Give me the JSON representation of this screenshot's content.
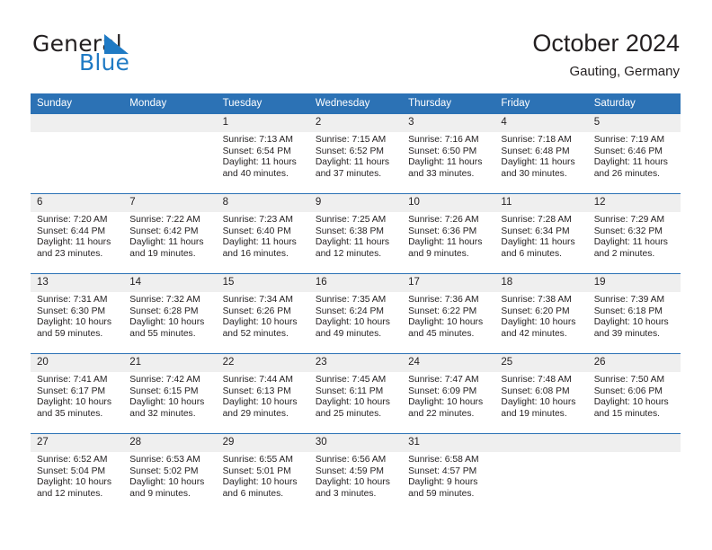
{
  "brand": {
    "word_general": "General",
    "word_blue": "Blue",
    "logo_icon": "triangle-flag-icon"
  },
  "header": {
    "title": "October 2024",
    "subtitle": "Gauting, Germany"
  },
  "theme": {
    "header_blue": "#2c72b5",
    "daynum_band": "#efefef",
    "text": "#231f20",
    "brand_blue": "#1f7ac4"
  },
  "weekday_headers": [
    "Sunday",
    "Monday",
    "Tuesday",
    "Wednesday",
    "Thursday",
    "Friday",
    "Saturday"
  ],
  "weeks": [
    [
      {
        "day": "",
        "blank": true
      },
      {
        "day": "",
        "blank": true
      },
      {
        "day": "1",
        "sunrise": "Sunrise: 7:13 AM",
        "sunset": "Sunset: 6:54 PM",
        "daylight1": "Daylight: 11 hours",
        "daylight2": "and 40 minutes."
      },
      {
        "day": "2",
        "sunrise": "Sunrise: 7:15 AM",
        "sunset": "Sunset: 6:52 PM",
        "daylight1": "Daylight: 11 hours",
        "daylight2": "and 37 minutes."
      },
      {
        "day": "3",
        "sunrise": "Sunrise: 7:16 AM",
        "sunset": "Sunset: 6:50 PM",
        "daylight1": "Daylight: 11 hours",
        "daylight2": "and 33 minutes."
      },
      {
        "day": "4",
        "sunrise": "Sunrise: 7:18 AM",
        "sunset": "Sunset: 6:48 PM",
        "daylight1": "Daylight: 11 hours",
        "daylight2": "and 30 minutes."
      },
      {
        "day": "5",
        "sunrise": "Sunrise: 7:19 AM",
        "sunset": "Sunset: 6:46 PM",
        "daylight1": "Daylight: 11 hours",
        "daylight2": "and 26 minutes."
      }
    ],
    [
      {
        "day": "6",
        "sunrise": "Sunrise: 7:20 AM",
        "sunset": "Sunset: 6:44 PM",
        "daylight1": "Daylight: 11 hours",
        "daylight2": "and 23 minutes."
      },
      {
        "day": "7",
        "sunrise": "Sunrise: 7:22 AM",
        "sunset": "Sunset: 6:42 PM",
        "daylight1": "Daylight: 11 hours",
        "daylight2": "and 19 minutes."
      },
      {
        "day": "8",
        "sunrise": "Sunrise: 7:23 AM",
        "sunset": "Sunset: 6:40 PM",
        "daylight1": "Daylight: 11 hours",
        "daylight2": "and 16 minutes."
      },
      {
        "day": "9",
        "sunrise": "Sunrise: 7:25 AM",
        "sunset": "Sunset: 6:38 PM",
        "daylight1": "Daylight: 11 hours",
        "daylight2": "and 12 minutes."
      },
      {
        "day": "10",
        "sunrise": "Sunrise: 7:26 AM",
        "sunset": "Sunset: 6:36 PM",
        "daylight1": "Daylight: 11 hours",
        "daylight2": "and 9 minutes."
      },
      {
        "day": "11",
        "sunrise": "Sunrise: 7:28 AM",
        "sunset": "Sunset: 6:34 PM",
        "daylight1": "Daylight: 11 hours",
        "daylight2": "and 6 minutes."
      },
      {
        "day": "12",
        "sunrise": "Sunrise: 7:29 AM",
        "sunset": "Sunset: 6:32 PM",
        "daylight1": "Daylight: 11 hours",
        "daylight2": "and 2 minutes."
      }
    ],
    [
      {
        "day": "13",
        "sunrise": "Sunrise: 7:31 AM",
        "sunset": "Sunset: 6:30 PM",
        "daylight1": "Daylight: 10 hours",
        "daylight2": "and 59 minutes."
      },
      {
        "day": "14",
        "sunrise": "Sunrise: 7:32 AM",
        "sunset": "Sunset: 6:28 PM",
        "daylight1": "Daylight: 10 hours",
        "daylight2": "and 55 minutes."
      },
      {
        "day": "15",
        "sunrise": "Sunrise: 7:34 AM",
        "sunset": "Sunset: 6:26 PM",
        "daylight1": "Daylight: 10 hours",
        "daylight2": "and 52 minutes."
      },
      {
        "day": "16",
        "sunrise": "Sunrise: 7:35 AM",
        "sunset": "Sunset: 6:24 PM",
        "daylight1": "Daylight: 10 hours",
        "daylight2": "and 49 minutes."
      },
      {
        "day": "17",
        "sunrise": "Sunrise: 7:36 AM",
        "sunset": "Sunset: 6:22 PM",
        "daylight1": "Daylight: 10 hours",
        "daylight2": "and 45 minutes."
      },
      {
        "day": "18",
        "sunrise": "Sunrise: 7:38 AM",
        "sunset": "Sunset: 6:20 PM",
        "daylight1": "Daylight: 10 hours",
        "daylight2": "and 42 minutes."
      },
      {
        "day": "19",
        "sunrise": "Sunrise: 7:39 AM",
        "sunset": "Sunset: 6:18 PM",
        "daylight1": "Daylight: 10 hours",
        "daylight2": "and 39 minutes."
      }
    ],
    [
      {
        "day": "20",
        "sunrise": "Sunrise: 7:41 AM",
        "sunset": "Sunset: 6:17 PM",
        "daylight1": "Daylight: 10 hours",
        "daylight2": "and 35 minutes."
      },
      {
        "day": "21",
        "sunrise": "Sunrise: 7:42 AM",
        "sunset": "Sunset: 6:15 PM",
        "daylight1": "Daylight: 10 hours",
        "daylight2": "and 32 minutes."
      },
      {
        "day": "22",
        "sunrise": "Sunrise: 7:44 AM",
        "sunset": "Sunset: 6:13 PM",
        "daylight1": "Daylight: 10 hours",
        "daylight2": "and 29 minutes."
      },
      {
        "day": "23",
        "sunrise": "Sunrise: 7:45 AM",
        "sunset": "Sunset: 6:11 PM",
        "daylight1": "Daylight: 10 hours",
        "daylight2": "and 25 minutes."
      },
      {
        "day": "24",
        "sunrise": "Sunrise: 7:47 AM",
        "sunset": "Sunset: 6:09 PM",
        "daylight1": "Daylight: 10 hours",
        "daylight2": "and 22 minutes."
      },
      {
        "day": "25",
        "sunrise": "Sunrise: 7:48 AM",
        "sunset": "Sunset: 6:08 PM",
        "daylight1": "Daylight: 10 hours",
        "daylight2": "and 19 minutes."
      },
      {
        "day": "26",
        "sunrise": "Sunrise: 7:50 AM",
        "sunset": "Sunset: 6:06 PM",
        "daylight1": "Daylight: 10 hours",
        "daylight2": "and 15 minutes."
      }
    ],
    [
      {
        "day": "27",
        "sunrise": "Sunrise: 6:52 AM",
        "sunset": "Sunset: 5:04 PM",
        "daylight1": "Daylight: 10 hours",
        "daylight2": "and 12 minutes."
      },
      {
        "day": "28",
        "sunrise": "Sunrise: 6:53 AM",
        "sunset": "Sunset: 5:02 PM",
        "daylight1": "Daylight: 10 hours",
        "daylight2": "and 9 minutes."
      },
      {
        "day": "29",
        "sunrise": "Sunrise: 6:55 AM",
        "sunset": "Sunset: 5:01 PM",
        "daylight1": "Daylight: 10 hours",
        "daylight2": "and 6 minutes."
      },
      {
        "day": "30",
        "sunrise": "Sunrise: 6:56 AM",
        "sunset": "Sunset: 4:59 PM",
        "daylight1": "Daylight: 10 hours",
        "daylight2": "and 3 minutes."
      },
      {
        "day": "31",
        "sunrise": "Sunrise: 6:58 AM",
        "sunset": "Sunset: 4:57 PM",
        "daylight1": "Daylight: 9 hours",
        "daylight2": "and 59 minutes."
      },
      {
        "day": "",
        "blank": true
      },
      {
        "day": "",
        "blank": true
      }
    ]
  ]
}
